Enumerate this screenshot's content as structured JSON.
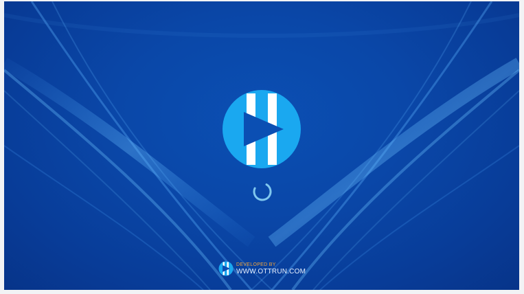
{
  "splash": {
    "developed_by_label": "DEVELOPED BY",
    "developer_url": "WWW.OTTRUN.COM"
  },
  "colors": {
    "background": "#0a47a8",
    "logo_circle": "#1aa8f0",
    "logo_play": "#0b4fb3",
    "spinner": "#7fc7ee",
    "developed_by": "#f3a53a",
    "url_text": "#e8f1ff"
  },
  "icons": {
    "main_logo": "play-logo-icon",
    "loading": "loading-spinner-icon",
    "footer_logo": "ottrun-logo-icon"
  }
}
